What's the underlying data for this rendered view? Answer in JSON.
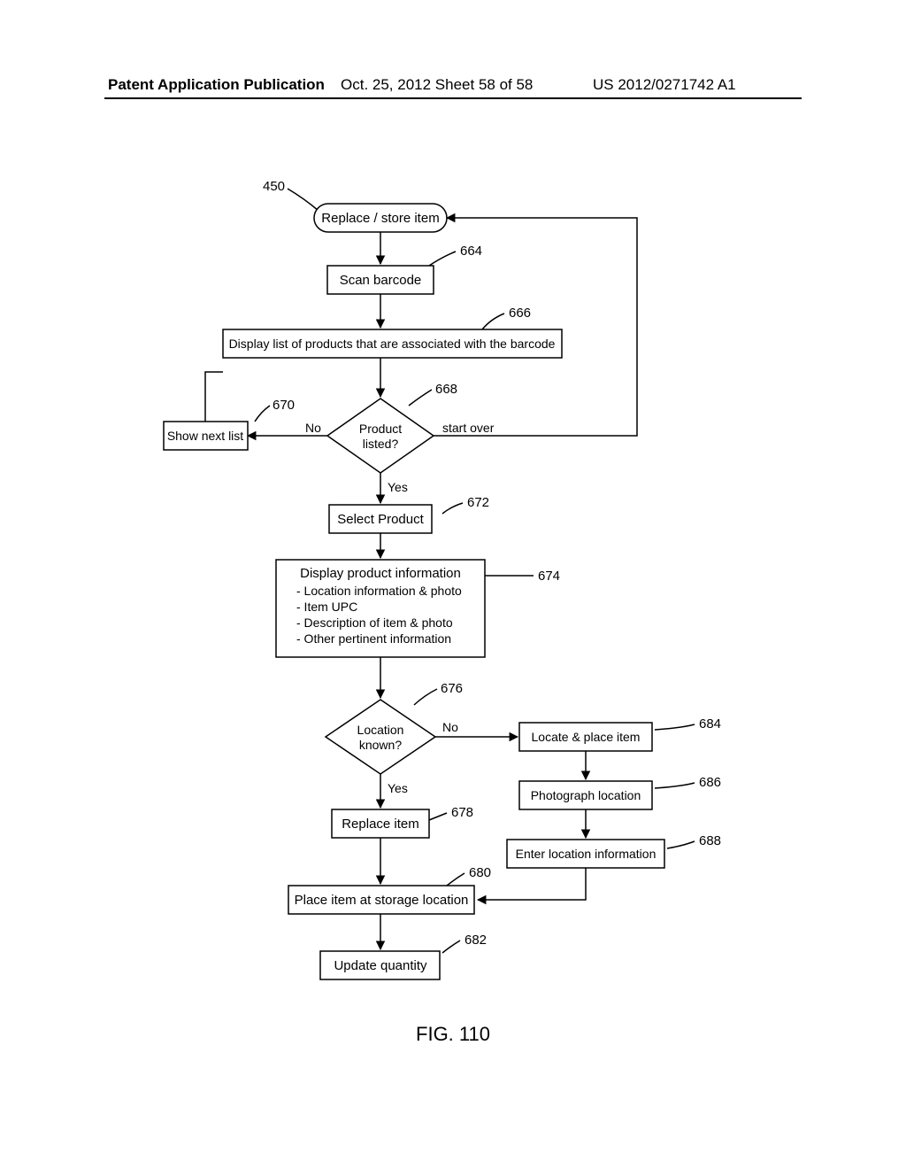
{
  "header": {
    "left": "Patent Application Publication",
    "mid": "Oct. 25, 2012  Sheet 58 of 58",
    "right": "US 2012/0271742 A1"
  },
  "figure_caption": "FIG. 110",
  "labels": {
    "n450": "450",
    "n664": "664",
    "n666": "666",
    "n668": "668",
    "n670": "670",
    "n672": "672",
    "n674": "674",
    "n676": "676",
    "n678": "678",
    "n680": "680",
    "n682": "682",
    "n684": "684",
    "n686": "686",
    "n688": "688"
  },
  "nodes": {
    "start": "Replace / store item",
    "scan": "Scan barcode",
    "list": "Display list of products that are associated with the barcode",
    "decision_listed": {
      "text1": "Product",
      "text2": "listed?"
    },
    "show_next": "Show next list",
    "select": "Select Product",
    "info": {
      "title": "Display product information",
      "lines": [
        "- Location information & photo",
        "- Item UPC",
        "- Description of item & photo",
        "- Other pertinent information"
      ]
    },
    "decision_location": {
      "text1": "Location",
      "text2": "known?"
    },
    "replace": "Replace item",
    "place_storage": "Place item at storage location",
    "update": "Update quantity",
    "locate_place": "Locate & place item",
    "photo_loc": "Photograph location",
    "enter_loc": "Enter location information"
  },
  "edges": {
    "no": "No",
    "yes": "Yes",
    "start_over": "start over"
  }
}
